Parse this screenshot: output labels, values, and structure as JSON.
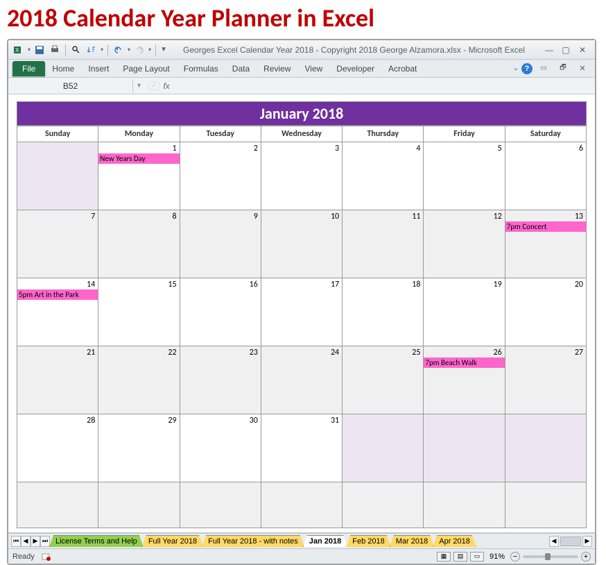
{
  "page_title": "2018 Calendar Year Planner in Excel",
  "window_title": "Georges Excel Calendar Year 2018  -  Copyright 2018 George Alzamora.xlsx  -  Microsoft Excel",
  "ribbon": {
    "file": "File",
    "tabs": [
      "Home",
      "Insert",
      "Page Layout",
      "Formulas",
      "Data",
      "Review",
      "View",
      "Developer",
      "Acrobat"
    ]
  },
  "namebox": "B52",
  "formula_label": "fx",
  "formula_value": "",
  "calendar": {
    "title": "January 2018",
    "days": [
      "Sunday",
      "Monday",
      "Tuesday",
      "Wednesday",
      "Thursday",
      "Friday",
      "Saturday"
    ],
    "weeks": [
      [
        {
          "num": "",
          "shade": "lightpurple"
        },
        {
          "num": "1",
          "event": "New Years Day"
        },
        {
          "num": "2"
        },
        {
          "num": "3"
        },
        {
          "num": "4"
        },
        {
          "num": "5"
        },
        {
          "num": "6"
        }
      ],
      [
        {
          "num": "7",
          "shade": "shade"
        },
        {
          "num": "8",
          "shade": "shade"
        },
        {
          "num": "9",
          "shade": "shade"
        },
        {
          "num": "10",
          "shade": "shade"
        },
        {
          "num": "11",
          "shade": "shade"
        },
        {
          "num": "12",
          "shade": "shade"
        },
        {
          "num": "13",
          "shade": "shade",
          "event": "7pm Concert"
        }
      ],
      [
        {
          "num": "14",
          "event": "5pm Art in the Park"
        },
        {
          "num": "15"
        },
        {
          "num": "16"
        },
        {
          "num": "17"
        },
        {
          "num": "18"
        },
        {
          "num": "19"
        },
        {
          "num": "20"
        }
      ],
      [
        {
          "num": "21",
          "shade": "shade"
        },
        {
          "num": "22",
          "shade": "shade"
        },
        {
          "num": "23",
          "shade": "shade"
        },
        {
          "num": "24",
          "shade": "shade"
        },
        {
          "num": "25",
          "shade": "shade"
        },
        {
          "num": "26",
          "shade": "shade",
          "event": "7pm Beach Walk"
        },
        {
          "num": "27",
          "shade": "shade"
        }
      ],
      [
        {
          "num": "28"
        },
        {
          "num": "29"
        },
        {
          "num": "30"
        },
        {
          "num": "31"
        },
        {
          "num": "",
          "shade": "lightpurple"
        },
        {
          "num": "",
          "shade": "lightpurple"
        },
        {
          "num": "",
          "shade": "lightpurple"
        }
      ],
      [
        {
          "num": "",
          "shade": "shade"
        },
        {
          "num": "",
          "shade": "shade"
        },
        {
          "num": "",
          "shade": "shade"
        },
        {
          "num": "",
          "shade": "shade"
        },
        {
          "num": "",
          "shade": "shade"
        },
        {
          "num": "",
          "shade": "shade"
        },
        {
          "num": "",
          "shade": "shade"
        }
      ]
    ]
  },
  "sheet_tabs": [
    {
      "label": "License Terms and Help",
      "cls": "green"
    },
    {
      "label": "Full Year 2018",
      "cls": "yellow"
    },
    {
      "label": "Full Year 2018 - with notes",
      "cls": "yellow"
    },
    {
      "label": "Jan 2018",
      "cls": "active"
    },
    {
      "label": "Feb 2018",
      "cls": "yellow"
    },
    {
      "label": "Mar 2018",
      "cls": "yellow"
    },
    {
      "label": "Apr 2018",
      "cls": "yellow"
    }
  ],
  "status": {
    "ready": "Ready",
    "zoom": "91%"
  }
}
